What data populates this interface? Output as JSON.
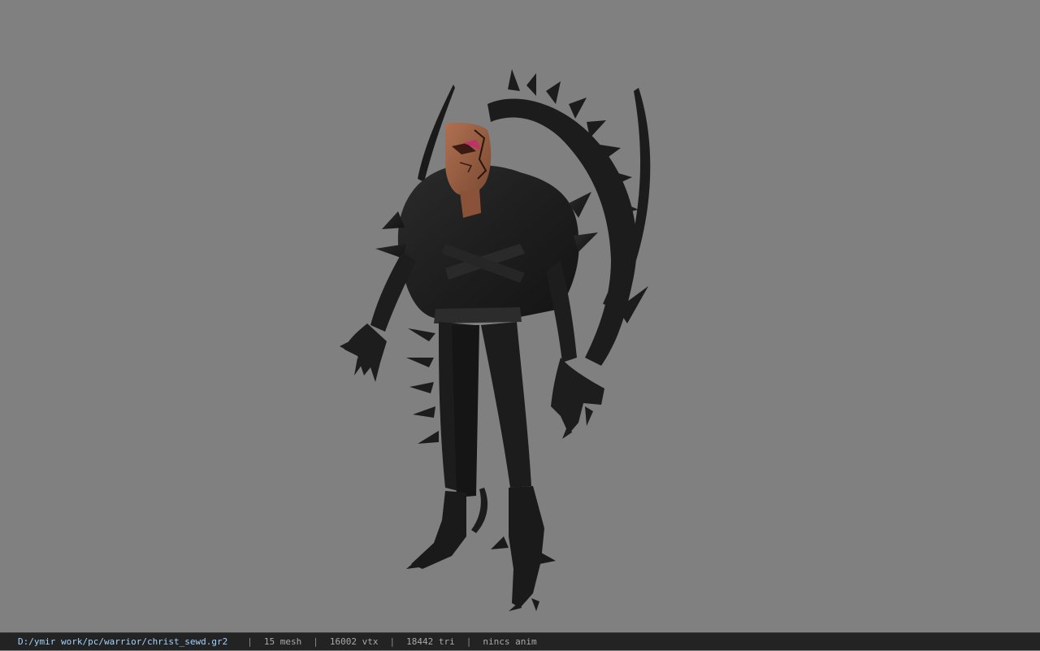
{
  "viewer": {
    "background_color": "#808080",
    "model_icon": "character-model-icon"
  },
  "status_bar": {
    "file_path": "D:/ymir work/pc/warrior/christ_sewd.gr2",
    "separator": "|",
    "mesh_count": "15 mesh",
    "vertex_count": "16002 vtx",
    "triangle_count": "18442 tri",
    "animation_status": "nincs anim"
  }
}
